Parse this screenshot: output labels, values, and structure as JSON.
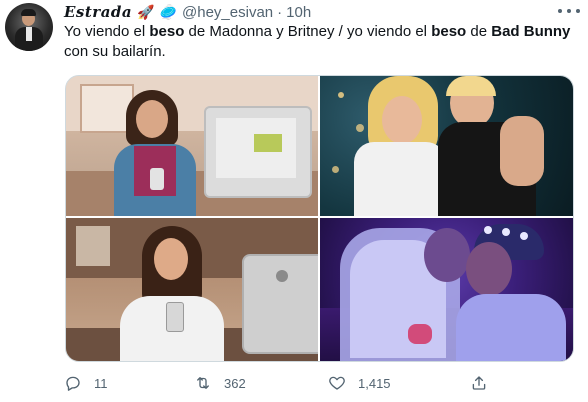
{
  "tweet": {
    "display_name": "Estrada",
    "emojis": [
      "🚀",
      "🥏"
    ],
    "handle": "@hey_esivan",
    "separator": "·",
    "time": "10h",
    "text": {
      "part1": "Yo viendo el ",
      "bold1": "beso",
      "part2": " de Madonna y Britney / yo viendo el ",
      "bold2": "beso",
      "part3": " de ",
      "bold3": "Bad Bunny",
      "part4": " con su bailarín."
    },
    "actions": {
      "replies": "11",
      "retweets": "362",
      "likes": "1,415"
    }
  },
  "icons": {
    "more": "more-dots-icon",
    "reply": "reply-bubble-icon",
    "retweet": "retweet-icon",
    "like": "heart-icon",
    "share": "share-upload-icon"
  },
  "colors": {
    "text": "#0f1419",
    "secondary": "#536471",
    "border": "#cfd9de"
  }
}
